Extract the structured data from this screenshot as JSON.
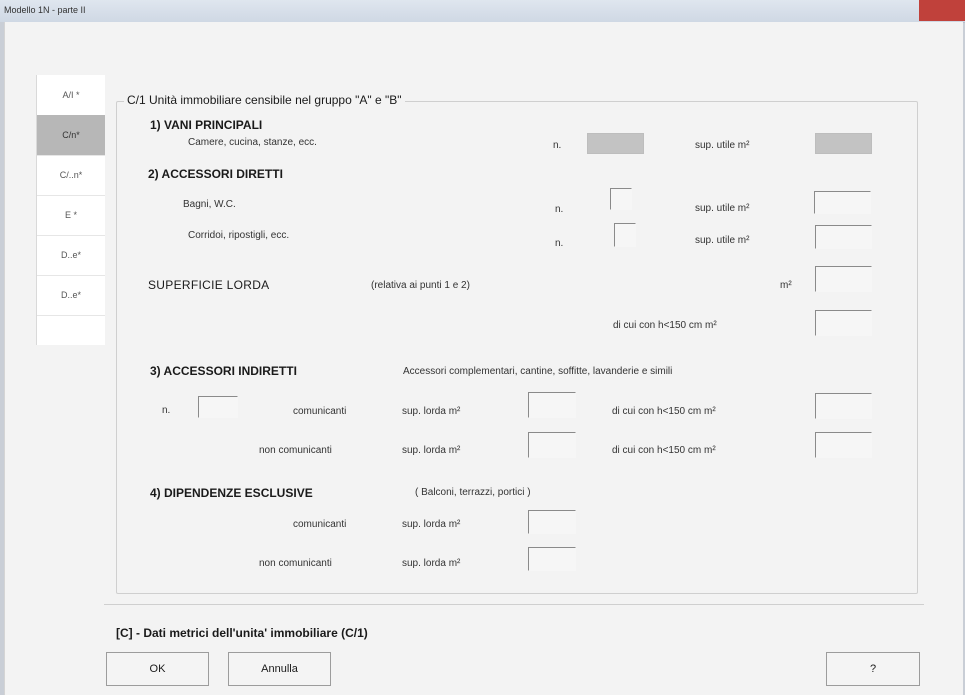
{
  "window": {
    "title": "Modello 1N - parte II"
  },
  "tabs": [
    {
      "label": "A/I *",
      "selected": false
    },
    {
      "label": "C/n*",
      "selected": true
    },
    {
      "label": "C/..n*",
      "selected": false
    },
    {
      "label": "E *",
      "selected": false
    },
    {
      "label": "D..e*",
      "selected": false
    },
    {
      "label": "D..e*",
      "selected": false
    }
  ],
  "group": {
    "title": "C/1  Unità immobiliare censibile nel gruppo \"A\" e \"B\""
  },
  "vani": {
    "heading": "1) VANI PRINCIPALI",
    "desc": "Camere, cucina, stanze, ecc.",
    "n_label": "n.",
    "sup_label": "sup. utile m²"
  },
  "accessori_diretti": {
    "heading": "2) ACCESSORI DIRETTI",
    "rows": [
      {
        "label": "Bagni, W.C.",
        "n_label": "n.",
        "sup_label": "sup. utile m²"
      },
      {
        "label": "Corridoi, ripostigli, ecc.",
        "n_label": "n.",
        "sup_label": "sup. utile m²"
      }
    ]
  },
  "superficie": {
    "heading": "SUPERFICIE LORDA",
    "note": "(relativa ai punti 1 e 2)",
    "m2_label": "m²",
    "dicui_label": "di cui con h<150 cm  m²"
  },
  "accessori_indiretti": {
    "heading": "3) ACCESSORI INDIRETTI",
    "note": "Accessori complementari, cantine, soffitte, lavanderie e simili",
    "n_label": "n.",
    "rows": [
      {
        "label": "comunicanti",
        "sup_label": "sup. lorda m²",
        "dicui_label": "di cui con h<150 cm  m²"
      },
      {
        "label": "non comunicanti",
        "sup_label": "sup. lorda m²",
        "dicui_label": "di cui con h<150 cm  m²"
      }
    ]
  },
  "dipendenze": {
    "heading": "4) DIPENDENZE ESCLUSIVE",
    "note": "( Balconi, terrazzi, portici )",
    "rows": [
      {
        "label": "comunicanti",
        "sup_label": "sup. lorda m²"
      },
      {
        "label": "non comunicanti",
        "sup_label": "sup. lorda m²"
      }
    ]
  },
  "footer": {
    "caption": "[C] - Dati metrici dell'unita' immobiliare (C/1)",
    "ok": "OK",
    "cancel": "Annulla",
    "help": "?"
  }
}
